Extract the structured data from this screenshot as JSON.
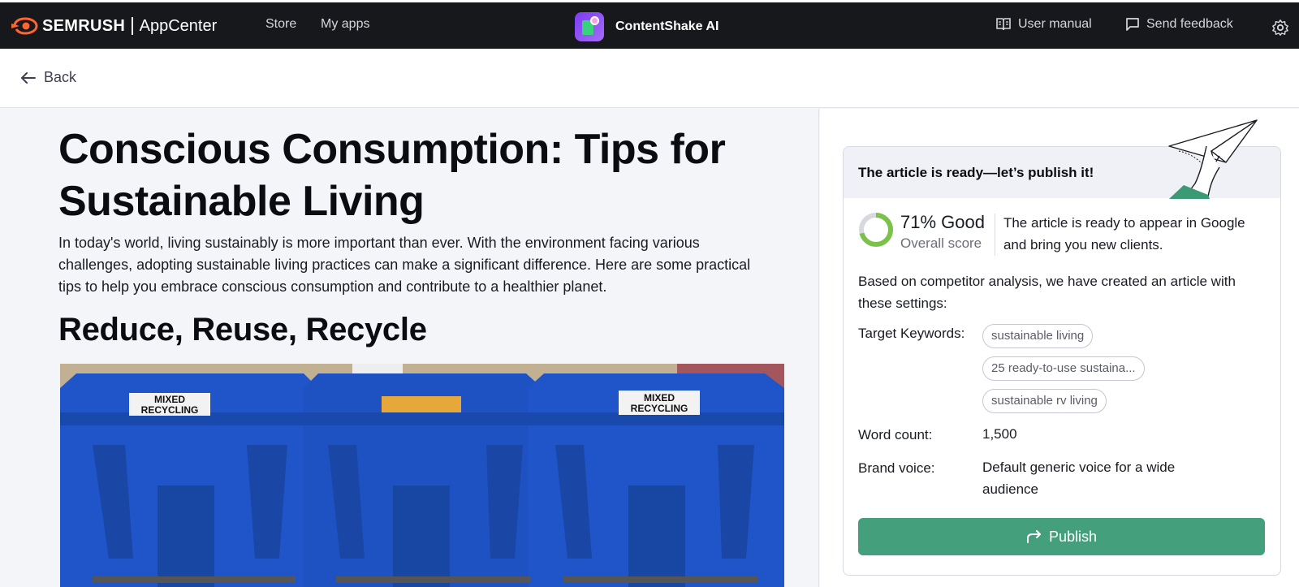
{
  "topbar": {
    "brand": "SEMRUSH",
    "brand_suffix": "AppCenter",
    "nav": [
      "Store",
      "My apps"
    ],
    "app_name": "ContentShake AI",
    "user_manual": "User manual",
    "send_feedback": "Send feedback",
    "icons": [
      "semrush-logo-icon",
      "contentshake-app-icon",
      "book-icon",
      "chat-icon",
      "gear-icon"
    ]
  },
  "back": {
    "label": "Back"
  },
  "article": {
    "title": "Conscious Consumption: Tips for Sustainable Living",
    "intro": "In today's world, living sustainably is more important than ever. With the environment facing various challenges, adopting sustainable living practices can make a significant difference. Here are some practical tips to help you embrace conscious consumption and contribute to a healthier planet.",
    "h2": "Reduce, Reuse, Recycle",
    "image_bin_labels": [
      "MIXED",
      "RECYCLING",
      "MIXED",
      "RECYCLING"
    ]
  },
  "panel": {
    "header": "The article is ready—let’s publish it!",
    "score_value": "71% Good",
    "score_percent": 71,
    "score_label": "Overall score",
    "score_desc": "The article is ready to appear in Google and bring you new clients.",
    "based_on": "Based on competitor analysis, we have created an article with these settings:",
    "keywords_label": "Target Keywords:",
    "keywords": [
      "sustainable living",
      "25 ready-to-use sustaina...",
      "sustainable rv living"
    ],
    "word_count_label": "Word count:",
    "word_count": "1,500",
    "brand_voice_label": "Brand voice:",
    "brand_voice": "Default generic voice for a wide audience",
    "publish_label": "Publish"
  },
  "colors": {
    "topbar": "#17181c",
    "accent_orange": "#ff642d",
    "score_green": "#7bc24a",
    "publish_green": "#449f7d",
    "bin_blue": "#1f55c9"
  }
}
